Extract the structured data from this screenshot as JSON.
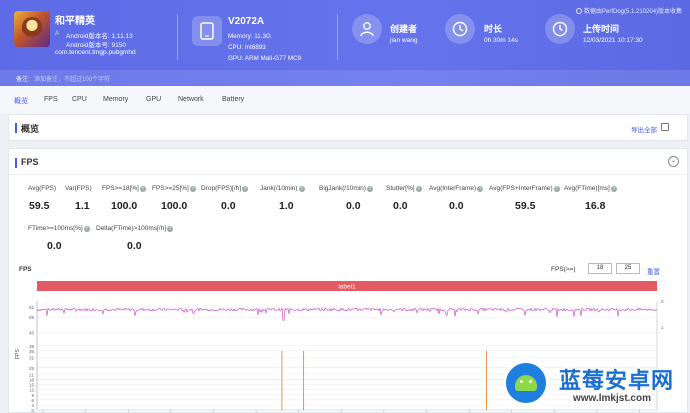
{
  "app": {
    "name": "和平精英",
    "android_version": "Android版本名: 1.11.13",
    "android_code": "Android版本号: 9150",
    "package": "com.tencent.tmgp.pubgmhd",
    "android_badge": "A"
  },
  "remark": {
    "label": "备注:",
    "hint": "添加备注，不超过100个字符"
  },
  "device": {
    "name": "V2072A",
    "memory": "Memory: 11.3G",
    "cpu": "CPU: mt6893",
    "gpu": "GPU: ARM Mali-G77 MC9"
  },
  "creator": {
    "title": "创建者",
    "value": "jian wang"
  },
  "duration": {
    "title": "时长",
    "value": "0h 30m 14s"
  },
  "upload": {
    "title": "上传时间",
    "value": "12/03/2021 10:17:30"
  },
  "perfdog_note": "数据由PerfDog(5.1.210204)版本收集",
  "tabs": [
    "概览",
    "FPS",
    "CPU",
    "Memory",
    "GPU",
    "Network",
    "Battery"
  ],
  "overview": {
    "title": "概览",
    "export": "导出全部"
  },
  "fps_panel": {
    "title": "FPS",
    "collapse": "⌄",
    "stats_row1": [
      {
        "label": "Avg(FPS)",
        "value": "59.5"
      },
      {
        "label": "Var(FPS)",
        "value": "1.1"
      },
      {
        "label": "FPS>=18[%]",
        "value": "100.0"
      },
      {
        "label": "FPS>=25[%]",
        "value": "100.0"
      },
      {
        "label": "Drop(FPS)[/h]",
        "value": "0.0"
      },
      {
        "label": "Jank(/10min)",
        "value": "1.0"
      },
      {
        "label": "BigJank(/10min)",
        "value": "0.0"
      },
      {
        "label": "Stutter[%]",
        "value": "0.0"
      },
      {
        "label": "Avg(InterFrame)",
        "value": "0.0"
      },
      {
        "label": "Avg(FPS+InterFrame)",
        "value": "59.5"
      },
      {
        "label": "Avg(FTime)[ms]",
        "value": "16.8"
      }
    ],
    "stats_row2": [
      {
        "label": "FTime>=100ms[%]",
        "value": "0.0"
      },
      {
        "label": "Delta(FTime)>100ms[/h]",
        "value": "0.0"
      }
    ],
    "chart_title": "FPS",
    "threshold_label": "FPS(>=)",
    "threshold_1": "18",
    "threshold_2": "25",
    "reset": "重置"
  },
  "chart_data": {
    "type": "line",
    "title": "FPS",
    "label_band": "label1",
    "ylabel": "FPS",
    "y_ticks": [
      0,
      3,
      6,
      9,
      12,
      15,
      18,
      21,
      25,
      31,
      35,
      38,
      46,
      55,
      61
    ],
    "right_ticks": [
      1,
      2
    ],
    "ylim": [
      0,
      61
    ],
    "x_ticks": [
      "00:00",
      "01:31",
      "03:02",
      "04:33",
      "06:04",
      "07:35",
      "09:06",
      "10:37",
      "12:08",
      "13:39",
      "15:10",
      "16:41",
      "18:12",
      "19:43",
      "21:14"
    ],
    "series": [
      {
        "name": "FPS",
        "color": "#c040c0",
        "mean": 59.5,
        "min_dips": [
          56,
          53,
          55
        ]
      },
      {
        "name": "Jank",
        "color": "#e88a2a",
        "spike_times_frac": [
          0.395,
          0.43,
          0.725
        ],
        "spike_value": 35
      }
    ],
    "grid": true
  },
  "watermark": {
    "text": "蓝莓安卓网",
    "url": "www.lmkjst.com"
  },
  "colors": {
    "accent": "#4a5ae0",
    "header": "#6070e8",
    "label_band": "#e45a63",
    "fps_line": "#c040c0",
    "jank": "#e88a2a"
  }
}
